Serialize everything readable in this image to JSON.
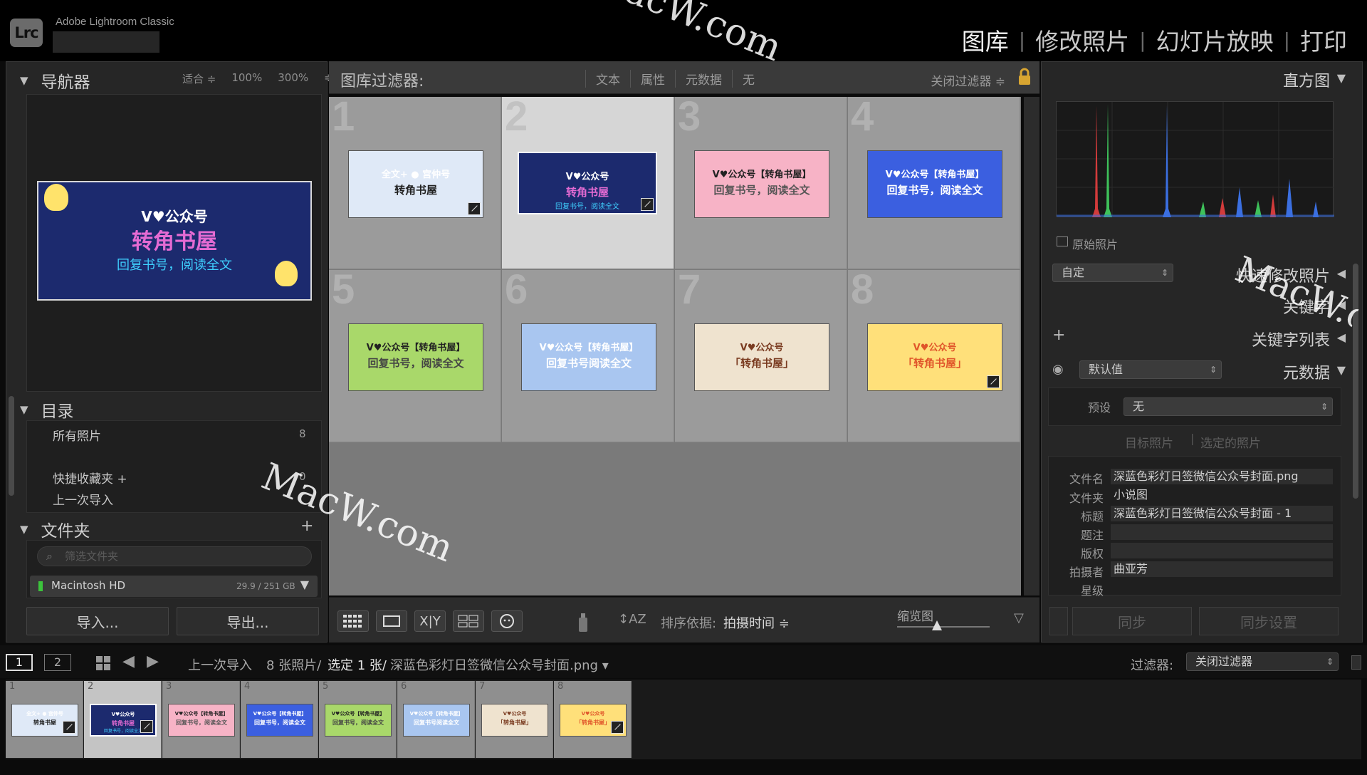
{
  "app": {
    "logo": "Lrc",
    "name": "Adobe Lightroom Classic",
    "modules": [
      {
        "label": "图库",
        "active": true
      },
      {
        "label": "修改照片",
        "active": false
      },
      {
        "label": "幻灯片放映",
        "active": false
      },
      {
        "label": "打印",
        "active": false
      }
    ]
  },
  "navigator": {
    "title": "导航器",
    "zoom": [
      "适合 ≑",
      "100%",
      "300%",
      "≑"
    ]
  },
  "catalog": {
    "title": "目录",
    "items": [
      {
        "label": "所有照片",
        "count": "8"
      },
      {
        "label": "快捷收藏夹 +",
        "count": "0"
      },
      {
        "label": "上一次导入",
        "count": ""
      }
    ]
  },
  "folders": {
    "title": "文件夹",
    "add": "+",
    "search_placeholder": "筛选文件夹",
    "volume": {
      "name": "Macintosh HD",
      "size": "29.9 / 251 GB"
    }
  },
  "buttons": {
    "import": "导入...",
    "export": "导出..."
  },
  "filter_bar": {
    "title": "图库过滤器:",
    "tabs": [
      "文本",
      "属性",
      "元数据",
      "无"
    ],
    "preset": "关闭过滤器 ≑"
  },
  "grid": {
    "cells": [
      {
        "num": "1",
        "selected": false,
        "edited": true,
        "bg": "#dfe9f7",
        "line1": "全文+ ● 宫仲号",
        "line2": "转角书屋",
        "line1_color": "#ffffff",
        "line2_color": "#222222"
      },
      {
        "num": "2",
        "selected": true,
        "edited": true,
        "bg": "#1c2a6e",
        "line1": "V♥公众号",
        "line2": "转角书屋",
        "line3": "回复书号，阅读全文",
        "line1_color": "#ffffff",
        "line2_color": "#e56bd3"
      },
      {
        "num": "3",
        "selected": false,
        "edited": false,
        "bg": "#f7b3c6",
        "line1": "V♥公众号【转角书屋】",
        "line2": "回复书号，阅读全文",
        "line1_color": "#222222",
        "line2_color": "#555555"
      },
      {
        "num": "4",
        "selected": false,
        "edited": false,
        "bg": "#3b5fe0",
        "line1": "V♥公众号【转角书屋】",
        "line2": "回复书号，阅读全文",
        "line1_color": "#ffffff",
        "line2_color": "#ffffff"
      },
      {
        "num": "5",
        "selected": false,
        "edited": false,
        "bg": "#a9d86a",
        "line1": "V♥公众号【转角书屋】",
        "line2": "回复书号，阅读全文",
        "line1_color": "#222222",
        "line2_color": "#444444"
      },
      {
        "num": "6",
        "selected": false,
        "edited": false,
        "bg": "#a9c6f0",
        "line1": "V♥公众号【转角书屋】",
        "line2": "回复书号阅读全文",
        "line1_color": "#ffffff",
        "line2_color": "#ffffff"
      },
      {
        "num": "7",
        "selected": false,
        "edited": false,
        "bg": "#efe3cf",
        "line1": "V♥公众号",
        "line2": "「转角书屋」",
        "line1_color": "#7a3b20",
        "line2_color": "#7a3b20"
      },
      {
        "num": "8",
        "selected": false,
        "edited": true,
        "bg": "#ffe07a",
        "line1": "V♥公众号",
        "line2": "「转角书屋」",
        "line1_color": "#e0552a",
        "line2_color": "#e0552a"
      }
    ]
  },
  "toolbar": {
    "sort_label": "排序依据:",
    "sort_value": "拍摄时间 ≑",
    "thumb_label": "缩览图"
  },
  "histogram": {
    "title": "直方图",
    "original_photo": "原始照片"
  },
  "right": {
    "quick_develop_preset": "自定",
    "quick_develop": "快速修改照片",
    "keywording": "关键字",
    "keyword_list": "关键字列表",
    "metadata_preset": "默认值",
    "metadata": "元数据",
    "preset_label": "预设",
    "preset_value": "无",
    "target_photo": "目标照片",
    "selected_photos": "选定的照片",
    "fields": [
      {
        "label": "文件名",
        "value": "深蓝色彩灯日签微信公众号封面.png"
      },
      {
        "label": "文件夹",
        "value": "小说图"
      },
      {
        "label": "标题",
        "value": "深蓝色彩灯日签微信公众号封面 - 1"
      },
      {
        "label": "题注",
        "value": ""
      },
      {
        "label": "版权",
        "value": ""
      },
      {
        "label": "拍摄者",
        "value": "曲亚芳"
      },
      {
        "label": "星级",
        "value": ""
      }
    ],
    "sync": "同步",
    "sync_settings": "同步设置"
  },
  "filmstrip": {
    "screen1": "1",
    "screen2": "2",
    "source": "上一次导入",
    "count": "8 张照片/",
    "selected": "选定 1 张/",
    "filename": "深蓝色彩灯日签微信公众号封面.png ▾",
    "filter_label": "过滤器:",
    "filter_value": "关闭过滤器"
  },
  "watermarks": [
    "MacW.com",
    "MacW.com",
    "MacW.c"
  ],
  "colors": {
    "accent_selected": "#d6d6d6",
    "panel": "#262626",
    "grid": "#9b9b9b"
  }
}
